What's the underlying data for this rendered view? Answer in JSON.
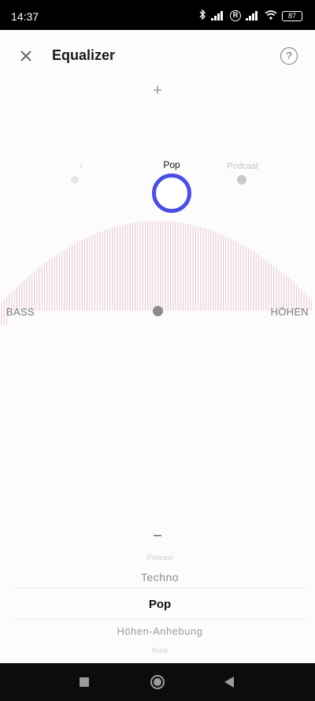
{
  "status_bar": {
    "time": "14:37",
    "battery": "87",
    "registered_mark": "R",
    "icons": [
      "bluetooth-icon",
      "signal-icon",
      "registered-icon",
      "signal-icon",
      "wifi-icon",
      "battery-icon"
    ]
  },
  "header": {
    "title": "Equalizer",
    "close_icon": "close-icon",
    "help_symbol": "?"
  },
  "controls": {
    "plus": "+",
    "minus": "–"
  },
  "presets_map": {
    "selected": "Pop",
    "right": "Podcast",
    "left_ghost": "i"
  },
  "axis": {
    "left": "BASS",
    "right": "HÖHEN"
  },
  "picker": {
    "items": [
      "Podcast",
      "Techno",
      "Pop",
      "Höhen-Anhebung",
      "Rock"
    ],
    "selected": "Pop"
  },
  "colors": {
    "accent": "#4a4fe0",
    "curve_lines": "#e8c9d2"
  },
  "nav_bar": {
    "icons": [
      "recents-icon",
      "home-icon",
      "back-icon"
    ]
  }
}
